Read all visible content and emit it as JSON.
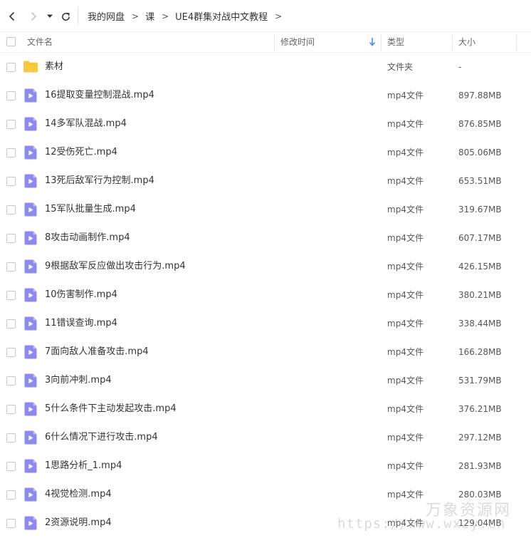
{
  "breadcrumb": [
    "我的网盘",
    "课",
    "UE4群集对战中文教程"
  ],
  "columns": {
    "name": "文件名",
    "modified": "修改时间",
    "type": "类型",
    "size": "大小"
  },
  "files": [
    {
      "name": "素材",
      "type": "文件夹",
      "size": "-",
      "kind": "folder"
    },
    {
      "name": "16提取变量控制混战.mp4",
      "type": "mp4文件",
      "size": "897.88MB",
      "kind": "video"
    },
    {
      "name": "14多军队混战.mp4",
      "type": "mp4文件",
      "size": "876.85MB",
      "kind": "video"
    },
    {
      "name": "12受伤死亡.mp4",
      "type": "mp4文件",
      "size": "805.06MB",
      "kind": "video"
    },
    {
      "name": "13死后敌军行为控制.mp4",
      "type": "mp4文件",
      "size": "653.51MB",
      "kind": "video"
    },
    {
      "name": "15军队批量生成.mp4",
      "type": "mp4文件",
      "size": "319.67MB",
      "kind": "video"
    },
    {
      "name": "8攻击动画制作.mp4",
      "type": "mp4文件",
      "size": "607.17MB",
      "kind": "video"
    },
    {
      "name": "9根据敌军反应做出攻击行为.mp4",
      "type": "mp4文件",
      "size": "426.15MB",
      "kind": "video"
    },
    {
      "name": "10伤害制作.mp4",
      "type": "mp4文件",
      "size": "380.21MB",
      "kind": "video"
    },
    {
      "name": "11错误查询.mp4",
      "type": "mp4文件",
      "size": "338.44MB",
      "kind": "video"
    },
    {
      "name": "7面向敌人准备攻击.mp4",
      "type": "mp4文件",
      "size": "166.28MB",
      "kind": "video"
    },
    {
      "name": "3向前冲刺.mp4",
      "type": "mp4文件",
      "size": "531.79MB",
      "kind": "video"
    },
    {
      "name": "5什么条件下主动发起攻击.mp4",
      "type": "mp4文件",
      "size": "376.21MB",
      "kind": "video"
    },
    {
      "name": "6什么情况下进行攻击.mp4",
      "type": "mp4文件",
      "size": "297.12MB",
      "kind": "video"
    },
    {
      "name": "1思路分析_1.mp4",
      "type": "mp4文件",
      "size": "281.93MB",
      "kind": "video"
    },
    {
      "name": "4视觉检测.mp4",
      "type": "mp4文件",
      "size": "280.03MB",
      "kind": "video"
    },
    {
      "name": "2资源说明.mp4",
      "type": "mp4文件",
      "size": "129.04MB",
      "kind": "video"
    }
  ],
  "watermark": {
    "line1": "万象资源网",
    "line2": "https://www.wxzy.cn"
  },
  "colors": {
    "video_icon": "#8c8cf0",
    "folder_icon": "#f9c941",
    "sort_arrow": "#3d8ef7"
  },
  "icons": {
    "back": "chevron-left-icon",
    "forward": "chevron-right-icon",
    "history": "caret-down-icon",
    "refresh": "refresh-icon",
    "sort": "sort-down-arrow-icon",
    "folder": "folder-icon",
    "video": "video-file-icon"
  }
}
